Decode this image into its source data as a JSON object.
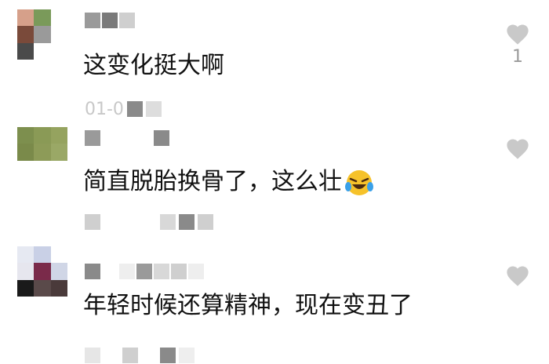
{
  "comments": [
    {
      "text": "这变化挺大啊",
      "meta_text": "01-0",
      "like_count": "1"
    },
    {
      "text": "简直脱胎换骨了，这么壮",
      "emoji": "laughing-tears-emoji",
      "like_count": ""
    },
    {
      "text": "年轻时候还算精神，现在变丑了",
      "like_count": ""
    }
  ],
  "icons": {
    "like": "heart-icon"
  },
  "colors": {
    "text": "#111111",
    "icon": "#c9c9c9",
    "meta": "#c8c8c8"
  }
}
